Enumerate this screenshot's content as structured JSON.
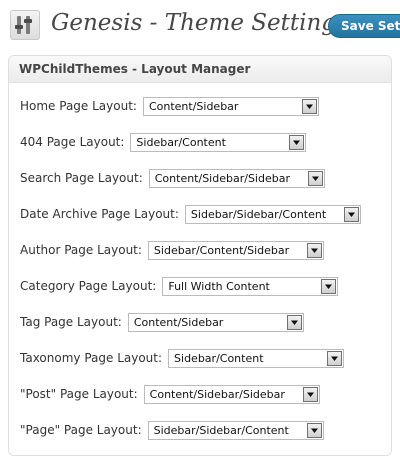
{
  "header": {
    "title": "Genesis - Theme Settings",
    "icon": "genesis-settings-icon",
    "save_label": "Save Sett"
  },
  "panel": {
    "title": "WPChildThemes - Layout Manager"
  },
  "rows": [
    {
      "label": "Home Page Layout:",
      "value": "Content/Sidebar"
    },
    {
      "label": "404 Page Layout:",
      "value": "Sidebar/Content"
    },
    {
      "label": "Search Page Layout:",
      "value": "Content/Sidebar/Sidebar"
    },
    {
      "label": "Date Archive Page Layout:",
      "value": "Sidebar/Sidebar/Content"
    },
    {
      "label": "Author Page Layout:",
      "value": "Sidebar/Content/Sidebar"
    },
    {
      "label": "Category Page Layout:",
      "value": "Full Width Content"
    },
    {
      "label": "Tag Page Layout:",
      "value": "Content/Sidebar"
    },
    {
      "label": "Taxonomy Page Layout:",
      "value": "Sidebar/Content"
    },
    {
      "label": "\"Post\" Page Layout:",
      "value": "Content/Sidebar/Sidebar"
    },
    {
      "label": "\"Page\" Page Layout:",
      "value": "Sidebar/Sidebar/Content"
    }
  ],
  "colors": {
    "accent": "#21759b",
    "title_text": "#464646",
    "border": "#dfdfdf"
  }
}
